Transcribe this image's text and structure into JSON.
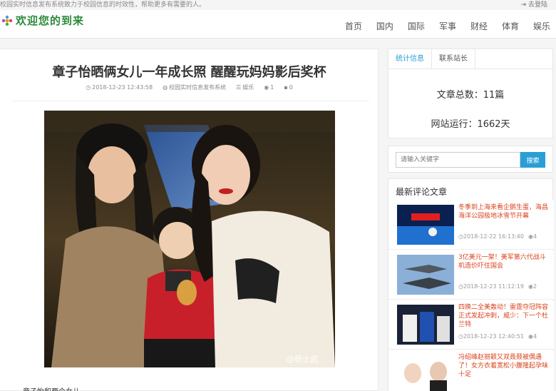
{
  "topbar": {
    "slogan": "校园实时信息发布系统致力于校园信息的时效性，帮助更多有需要的人。",
    "login": "去登陆"
  },
  "header": {
    "logo_text": "欢迎您的到来",
    "nav": [
      "首页",
      "国内",
      "国际",
      "军事",
      "财经",
      "体育",
      "娱乐"
    ]
  },
  "article": {
    "title": "章子怡晒俩女儿一年成长照 醒醒玩妈妈影后奖杯",
    "date": "2018-12-23 12:43:58",
    "source": "校园实时信息发布系统",
    "category": "娱乐",
    "views": "1",
    "comments": "0",
    "photo_watermark": "@杨士武",
    "caption": "章子怡和两个女儿"
  },
  "sidebar": {
    "tabs": [
      "统计信息",
      "联系站长"
    ],
    "total_articles": "文章总数：11篇",
    "uptime": "网站运行：1662天",
    "search_placeholder": "请输入关键字",
    "search_button": "搜索",
    "recent_title": "最新评论文章",
    "posts": [
      {
        "title": "冬季到上海来看企鹅生蛋，海昌海洋公园极地冰雪节开幕",
        "date": "2018-12-22 16:13:40",
        "count": "4"
      },
      {
        "title": "3亿美元一架！美军第六代战斗机造价吓住国会",
        "date": "2018-12-23 11:12:19",
        "count": "2"
      },
      {
        "title": "四换二全美轰动！雷霆夺冠阵容正式发起冲刺，威少：下一个杜兰特",
        "date": "2018-12-23 12:40:51",
        "count": "4"
      },
      {
        "title": "冯绍峰赵丽颖又双叒叕被偶遇了！女方衣着宽松小腹隆起孕味十足",
        "date": "",
        "count": ""
      }
    ]
  },
  "colors": {
    "accent": "#2a9fd6",
    "post_title": "#d8441f",
    "logo": "#2a8a3a"
  }
}
